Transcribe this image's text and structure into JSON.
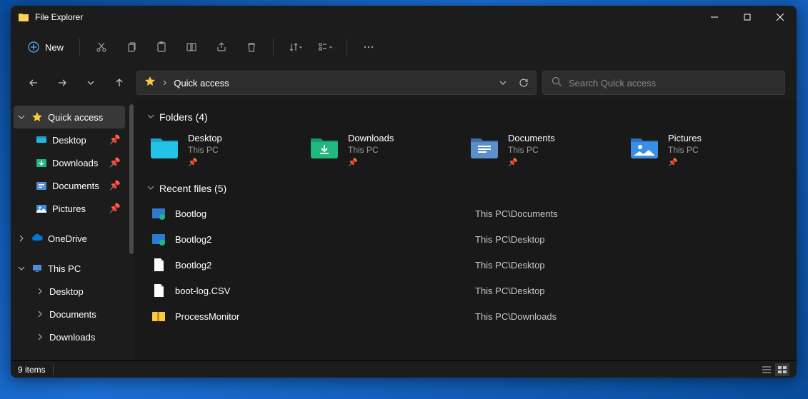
{
  "title": "File Explorer",
  "toolbar": {
    "new_label": "New"
  },
  "address": {
    "label": "Quick access"
  },
  "search": {
    "placeholder": "Search Quick access"
  },
  "sidebar": {
    "quick_access": "Quick access",
    "desktop": "Desktop",
    "downloads": "Downloads",
    "documents": "Documents",
    "pictures": "Pictures",
    "onedrive": "OneDrive",
    "this_pc": "This PC",
    "tp_desktop": "Desktop",
    "tp_documents": "Documents",
    "tp_downloads": "Downloads"
  },
  "groups": {
    "folders_header": "Folders (4)",
    "recent_header": "Recent files (5)"
  },
  "folders": [
    {
      "name": "Desktop",
      "loc": "This PC"
    },
    {
      "name": "Downloads",
      "loc": "This PC"
    },
    {
      "name": "Documents",
      "loc": "This PC"
    },
    {
      "name": "Pictures",
      "loc": "This PC"
    }
  ],
  "recent": [
    {
      "name": "Bootlog",
      "path": "This PC\\Documents"
    },
    {
      "name": "Bootlog2",
      "path": "This PC\\Desktop"
    },
    {
      "name": "Bootlog2",
      "path": "This PC\\Desktop"
    },
    {
      "name": "boot-log.CSV",
      "path": "This PC\\Desktop"
    },
    {
      "name": "ProcessMonitor",
      "path": "This PC\\Downloads"
    }
  ],
  "status": {
    "items": "9 items"
  }
}
